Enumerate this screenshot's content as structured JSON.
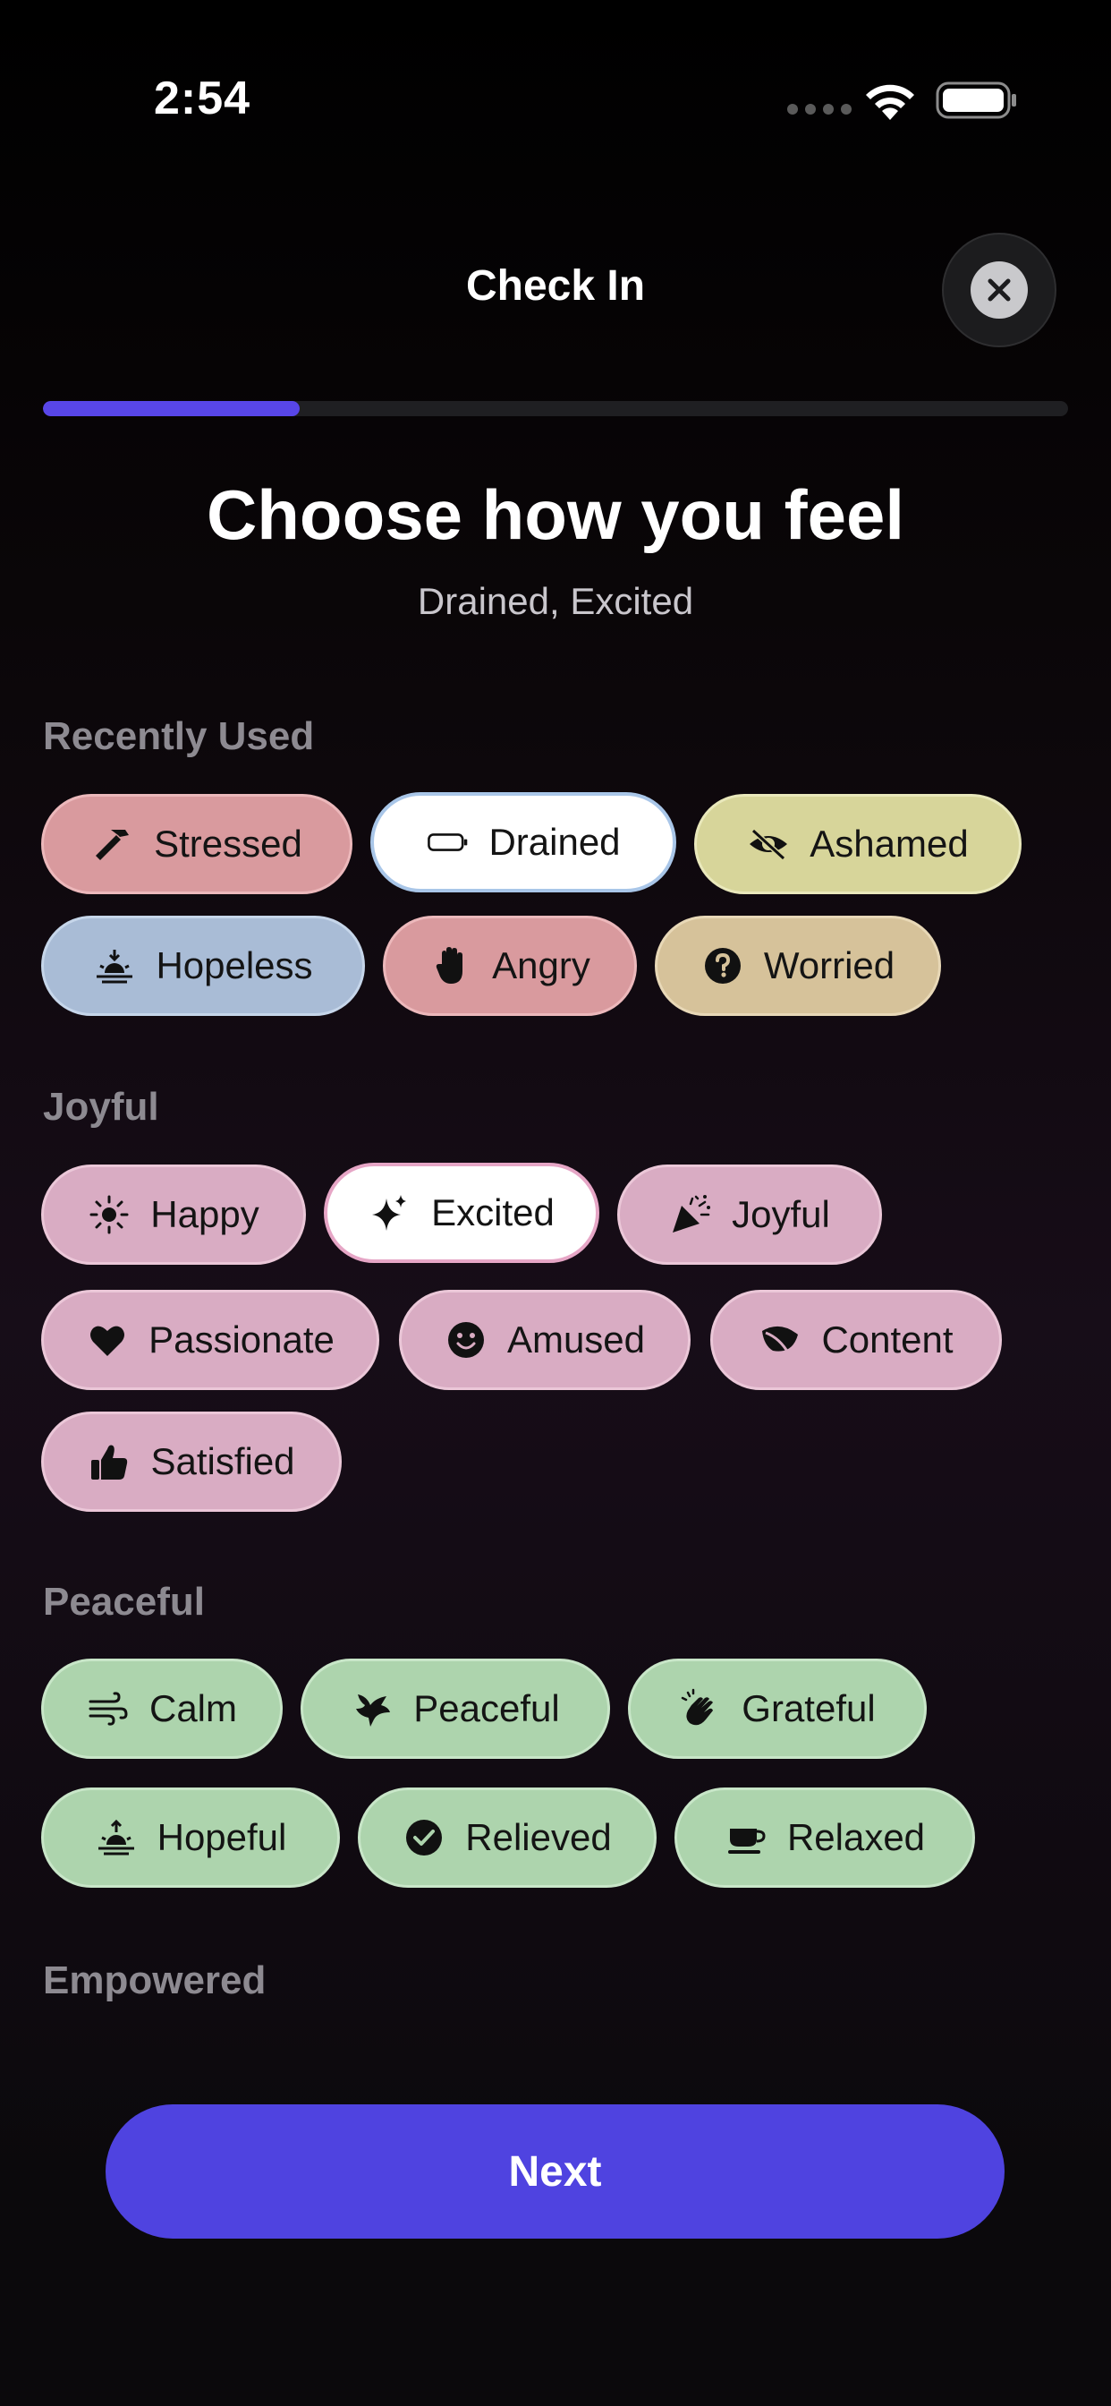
{
  "status_bar": {
    "time": "2:54"
  },
  "header": {
    "title": "Check In"
  },
  "progress": {
    "value": 0.25
  },
  "main": {
    "heading": "Choose how you feel",
    "selected_summary": "Drained, Excited"
  },
  "sections": [
    {
      "title": "Recently Used",
      "chips": [
        {
          "label": "Stressed",
          "icon": "hammer-icon",
          "color": "#d99a9e",
          "selected": false
        },
        {
          "label": "Drained",
          "icon": "battery-empty-icon",
          "color": "#a9bcd6",
          "selected": true
        },
        {
          "label": "Ashamed",
          "icon": "eye-slash-icon",
          "color": "#d7d59a",
          "selected": false
        },
        {
          "label": "Hopeless",
          "icon": "sunset-icon",
          "color": "#a9bcd6",
          "selected": false
        },
        {
          "label": "Angry",
          "icon": "raised-hand-icon",
          "color": "#d99a9e",
          "selected": false
        },
        {
          "label": "Worried",
          "icon": "question-circle-icon",
          "color": "#d6c29a",
          "selected": false
        }
      ]
    },
    {
      "title": "Joyful",
      "chips": [
        {
          "label": "Happy",
          "icon": "sun-icon",
          "color": "#d9acc3",
          "selected": false
        },
        {
          "label": "Excited",
          "icon": "sparkles-icon",
          "color": "#d9acc3",
          "selected": true
        },
        {
          "label": "Joyful",
          "icon": "party-popper-icon",
          "color": "#d9acc3",
          "selected": false
        },
        {
          "label": "Passionate",
          "icon": "heart-icon",
          "color": "#d9acc3",
          "selected": false
        },
        {
          "label": "Amused",
          "icon": "smiley-face-icon",
          "color": "#d9acc3",
          "selected": false
        },
        {
          "label": "Content",
          "icon": "leaf-icon",
          "color": "#d9acc3",
          "selected": false
        },
        {
          "label": "Satisfied",
          "icon": "thumbs-up-icon",
          "color": "#d9acc3",
          "selected": false
        }
      ]
    },
    {
      "title": "Peaceful",
      "chips": [
        {
          "label": "Calm",
          "icon": "wind-icon",
          "color": "#add4ad",
          "selected": false
        },
        {
          "label": "Peaceful",
          "icon": "bird-icon",
          "color": "#add4ad",
          "selected": false
        },
        {
          "label": "Grateful",
          "icon": "clapping-hands-icon",
          "color": "#add4ad",
          "selected": false
        },
        {
          "label": "Hopeful",
          "icon": "sunrise-icon",
          "color": "#add4ad",
          "selected": false
        },
        {
          "label": "Relieved",
          "icon": "checkmark-circle-icon",
          "color": "#add4ad",
          "selected": false
        },
        {
          "label": "Relaxed",
          "icon": "cup-icon",
          "color": "#add4ad",
          "selected": false
        }
      ]
    },
    {
      "title": "Empowered",
      "chips": []
    }
  ],
  "footer": {
    "next_label": "Next"
  },
  "colors": {
    "accent": "#5846e8",
    "button": "#4f43e0"
  }
}
